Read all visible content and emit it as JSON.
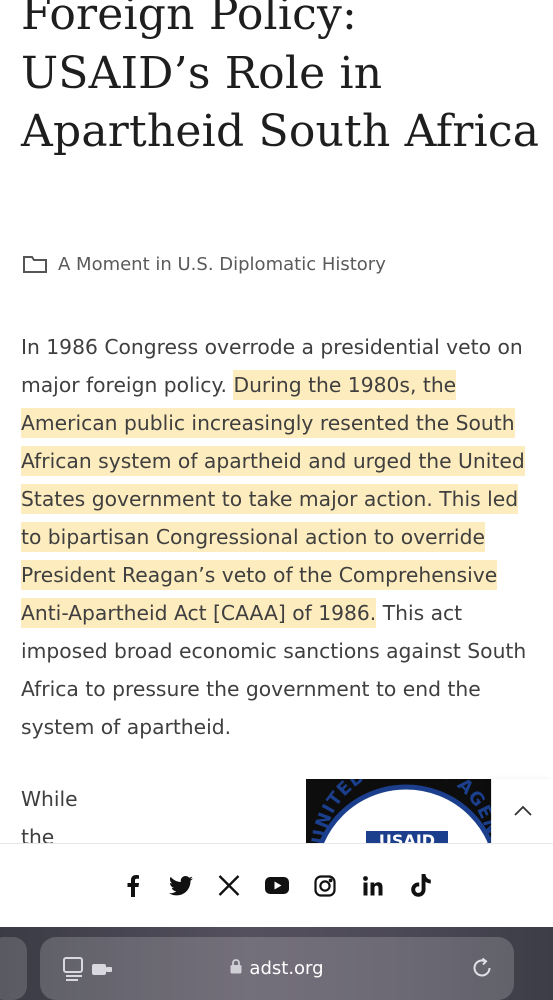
{
  "article": {
    "title": "Foreign Policy: USAID’s Role in Apartheid South Africa",
    "category": "A Moment in U.S. Diplomatic History",
    "paragraph": {
      "before": "In 1986 Congress overrode a presidential veto on major foreign policy. ",
      "highlight": "During the 1980s, the American public increasingly resented the South African system of apartheid and urged the United States government to take major action. This led to bipartisan Congressional action to override President Reagan’s veto of the Comprehensive Anti-Apartheid Act [CAAA] of 1986.",
      "after": " This act imposed broad economic sanctions against South Africa to pressure the government to end the system of apartheid."
    },
    "next_paragraph_start": "While the"
  },
  "logo": {
    "text": "UNITED STATES AGENCY",
    "badge": "USAID"
  },
  "social": {
    "icons": [
      "facebook-icon",
      "twitter-icon",
      "x-icon",
      "youtube-icon",
      "instagram-icon",
      "linkedin-icon",
      "tiktok-icon"
    ]
  },
  "browser": {
    "url": "adst.org"
  },
  "colors": {
    "highlight": "#fdecbe",
    "usaid_blue": "#1b3f8c"
  }
}
